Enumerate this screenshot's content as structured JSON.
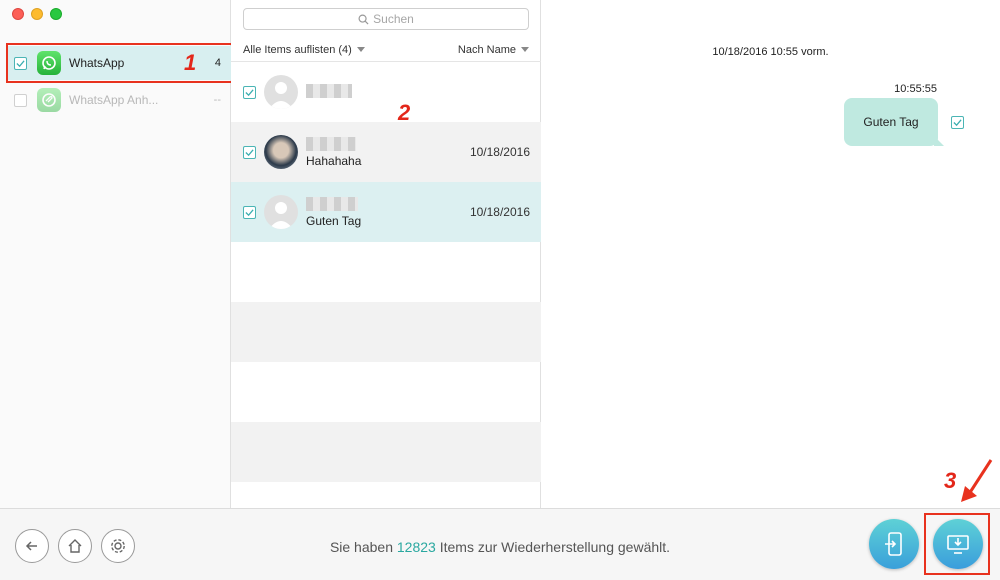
{
  "sidebar": {
    "items": [
      {
        "label": "WhatsApp",
        "count": "4",
        "checked": true
      },
      {
        "label": "WhatsApp Anh...",
        "count": "--",
        "checked": false
      }
    ]
  },
  "list": {
    "search_placeholder": "Suchen",
    "filter_label": "Alle Items auflisten (4)",
    "sort_label": "Nach Name",
    "rows": [
      {
        "subtitle": "",
        "date": ""
      },
      {
        "subtitle": "Hahahaha",
        "date": "10/18/2016"
      },
      {
        "subtitle": "Guten Tag",
        "date": "10/18/2016"
      }
    ]
  },
  "chat": {
    "date_header": "10/18/2016 10:55 vorm.",
    "message_time": "10:55:55",
    "message_text": "Guten Tag"
  },
  "bottom": {
    "status_prefix": "Sie haben ",
    "status_count": "12823",
    "status_suffix": " Items zur Wiederherstellung gewählt."
  },
  "annotations": {
    "step1": "1",
    "step2": "2",
    "step3": "3"
  },
  "colors": {
    "accent": "#2aa8a0",
    "selected_row": "#dcf0f1",
    "bubble": "#bfe9e0",
    "annotation_red": "#e8321e"
  }
}
